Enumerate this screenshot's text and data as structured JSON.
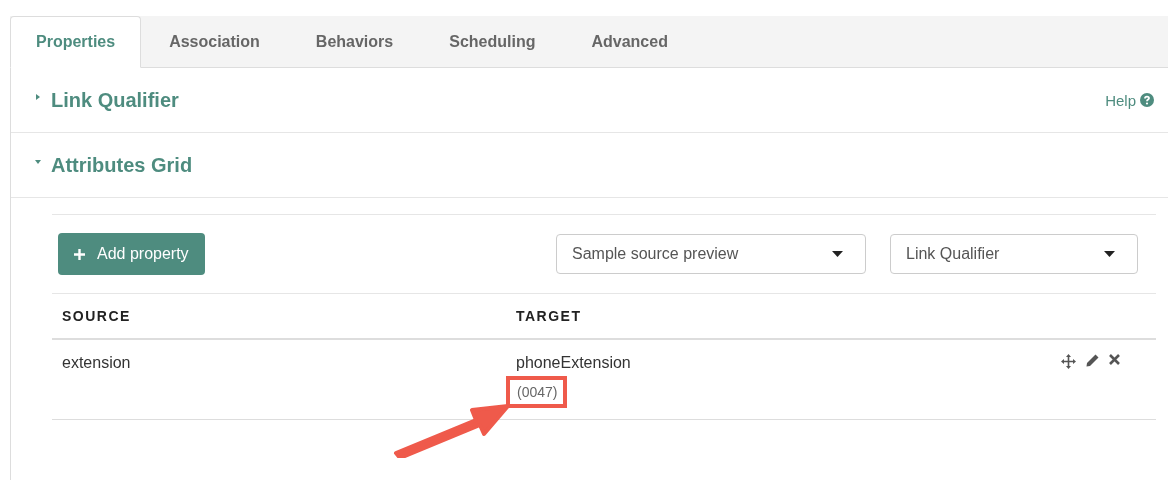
{
  "tabs": [
    {
      "label": "Properties",
      "selected": true
    },
    {
      "label": "Association",
      "selected": false
    },
    {
      "label": "Behaviors",
      "selected": false
    },
    {
      "label": "Scheduling",
      "selected": false
    },
    {
      "label": "Advanced",
      "selected": false
    }
  ],
  "sections": [
    {
      "title": "Link Qualifier",
      "expanded": false,
      "help": "Help"
    },
    {
      "title": "Attributes Grid",
      "expanded": true
    }
  ],
  "add_button": "Add property",
  "dropdowns": [
    {
      "value": "Sample source preview"
    },
    {
      "value": "Link Qualifier"
    }
  ],
  "table": {
    "columns": [
      "SOURCE",
      "TARGET"
    ],
    "rows": [
      {
        "source": "extension",
        "target": "phoneExtension",
        "target_note": "(0047)",
        "highlighted": true
      }
    ]
  }
}
